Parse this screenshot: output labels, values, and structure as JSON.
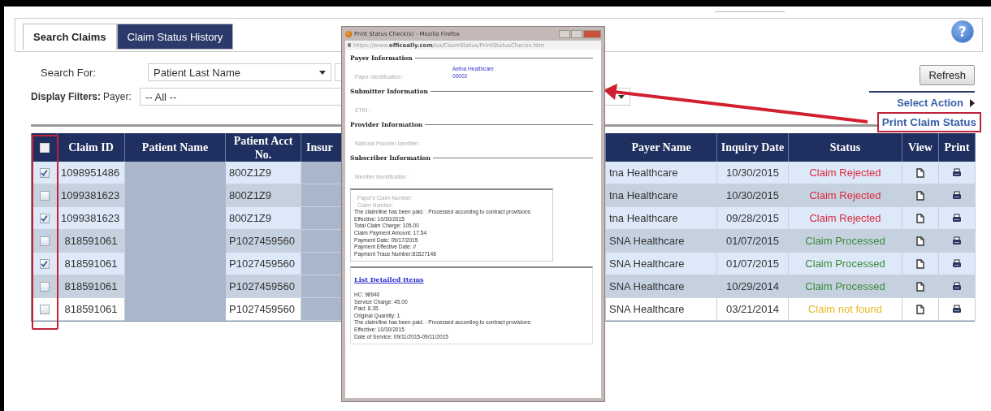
{
  "tabs": [
    {
      "label": "Search Claims",
      "selected": true
    },
    {
      "label": "Claim Status History",
      "selected": false
    }
  ],
  "help_button": {
    "label": "?"
  },
  "search": {
    "label": "Search For:",
    "field": "Patient Last Name"
  },
  "filters": {
    "label": "Display Filters:",
    "payer_label": "Payer:",
    "payer": "-- All --"
  },
  "refresh_button": "Refresh",
  "select_action": "Select Action",
  "print_claim_status": "Print Claim Status",
  "table": {
    "select_all_checked": false,
    "columns": [
      "Claim ID",
      "Patient Name",
      "Patient Acct No.",
      "Insur",
      "Payer Name",
      "Inquiry Date",
      "Status",
      "View",
      "Print"
    ],
    "rows": [
      {
        "checked": true,
        "claim_id": "1098951486",
        "patient_acct": "800Z1Z9",
        "payer": "tna Healthcare",
        "inquiry_date": "10/30/2015",
        "status": "Claim Rejected",
        "color": "#d92a3c"
      },
      {
        "checked": false,
        "claim_id": "1099381623",
        "patient_acct": "800Z1Z9",
        "payer": "tna Healthcare",
        "inquiry_date": "10/30/2015",
        "status": "Claim Rejected",
        "color": "#d92a3c"
      },
      {
        "checked": true,
        "claim_id": "1099381623",
        "patient_acct": "800Z1Z9",
        "payer": "tna Healthcare",
        "inquiry_date": "09/28/2015",
        "status": "Claim Rejected",
        "color": "#d92a3c"
      },
      {
        "checked": false,
        "claim_id": "818591061",
        "patient_acct": "P1027459560",
        "payer": "SNA Healthcare",
        "inquiry_date": "01/07/2015",
        "status": "Claim Processed",
        "color": "#3a8a3a"
      },
      {
        "checked": true,
        "claim_id": "818591061",
        "patient_acct": "P1027459560",
        "payer": "SNA Healthcare",
        "inquiry_date": "01/07/2015",
        "status": "Claim Processed",
        "color": "#3a8a3a"
      },
      {
        "checked": false,
        "claim_id": "818591061",
        "patient_acct": "P1027459560",
        "payer": "SNA Healthcare",
        "inquiry_date": "10/29/2014",
        "status": "Claim Processed",
        "color": "#3a8a3a"
      },
      {
        "checked": false,
        "claim_id": "818591061",
        "patient_acct": "P1027459560",
        "payer": "SNA Healthcare",
        "inquiry_date": "03/21/2014",
        "status": "Claim not found",
        "color": "#e8b923"
      }
    ]
  },
  "popup": {
    "title": "Print Status Check(s) - Mozilla Firefox",
    "url": "https://www.**officeally.com**/oa/ClaimStatus/PrintStatusChecks.htm",
    "sections": [
      {
        "heading": "Payer Information",
        "label": "Payor Identification :",
        "values": [
          "Aetna Healthcare",
          "00002"
        ]
      },
      {
        "heading": "Submitter Information",
        "label": "ETIN :"
      },
      {
        "heading": "Provider Information",
        "label": "National Provider Identifier :"
      },
      {
        "heading": "Subscriber Information",
        "label": "Member Identification :"
      }
    ],
    "claim_lines": [
      {
        "text": "Payor's Claim Number:",
        "kind": "muted"
      },
      {
        "text": "Claim Number:",
        "kind": "muted"
      },
      {
        "text": "The claim/line has been paid. : Processed according to contract provisions",
        "kind": "plain"
      },
      {
        "text": "Effective: 10/30/2015",
        "kind": "plain"
      },
      {
        "text": "Total Claim Charge: 105.00",
        "kind": "plain"
      },
      {
        "text": "Claim Payment Amount: 17.54",
        "kind": "plain"
      },
      {
        "text": "Payment Date: 09/17/2015",
        "kind": "plain"
      },
      {
        "text": "Payment Effective Date: //",
        "kind": "plain"
      },
      {
        "text": "Payment Trace Number:81527148",
        "kind": "plain"
      }
    ],
    "detail_link": "List Detailed Items",
    "detail_lines": [
      "HC: 98940",
      "Service Charge: 45.00",
      "Paid: 8.35",
      "Original Quantity: 1",
      "The claim/line has been paid. : Processed according to contract provisions",
      "Effective: 10/30/2015",
      "Date of Service: 09/11/2015-09/11/2015"
    ]
  }
}
